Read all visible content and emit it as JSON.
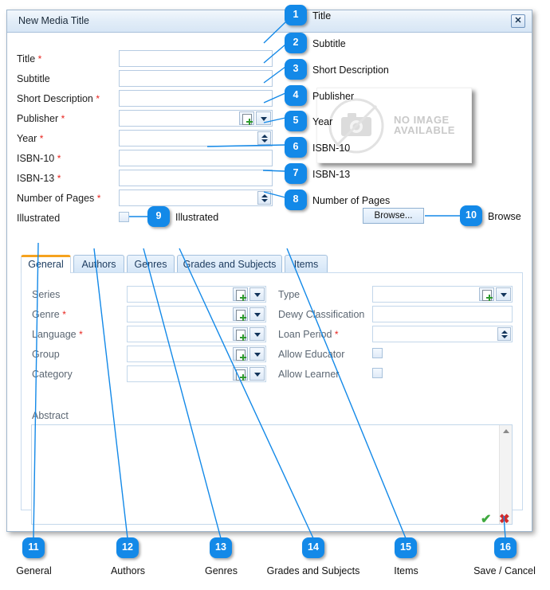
{
  "window": {
    "title": "New Media Title",
    "close_label": "✕"
  },
  "form": {
    "rows": [
      {
        "label": "Title",
        "required": "*",
        "control": "text"
      },
      {
        "label": "Subtitle",
        "required": "",
        "control": "text"
      },
      {
        "label": "Short Description",
        "required": "*",
        "control": "text"
      },
      {
        "label": "Publisher",
        "required": "*",
        "control": "lookup"
      },
      {
        "label": "Year",
        "required": "*",
        "control": "spinner"
      },
      {
        "label": "ISBN-10",
        "required": "*",
        "control": "text"
      },
      {
        "label": "ISBN-13",
        "required": "*",
        "control": "text"
      },
      {
        "label": "Number of Pages",
        "required": "*",
        "control": "spinner"
      },
      {
        "label": "Illustrated",
        "required": "",
        "control": "checkbox"
      }
    ]
  },
  "image_placeholder": {
    "line1": "NO IMAGE",
    "line2": "AVAILABLE"
  },
  "browse": {
    "label": "Browse..."
  },
  "tabs": [
    {
      "label": "General",
      "active": true
    },
    {
      "label": "Authors",
      "active": false
    },
    {
      "label": "Genres",
      "active": false
    },
    {
      "label": "Grades and Subjects",
      "active": false
    },
    {
      "label": "Items",
      "active": false
    }
  ],
  "general_tab": {
    "left_fields": [
      {
        "label": "Series",
        "required": "",
        "control": "lookup"
      },
      {
        "label": "Genre",
        "required": "*",
        "control": "lookup"
      },
      {
        "label": "Language",
        "required": "*",
        "control": "lookup"
      },
      {
        "label": "Group",
        "required": "",
        "control": "lookup"
      },
      {
        "label": "Category",
        "required": "",
        "control": "lookup"
      }
    ],
    "right_fields": [
      {
        "label": "Type",
        "required": "",
        "control": "lookup"
      },
      {
        "label": "Dewy Classification",
        "required": "",
        "control": "text"
      },
      {
        "label": "Loan Period",
        "required": "*",
        "control": "spinner"
      },
      {
        "label": "Allow Educator",
        "required": "",
        "control": "checkbox"
      },
      {
        "label": "Allow Learner",
        "required": "",
        "control": "checkbox"
      }
    ],
    "abstract_label": "Abstract"
  },
  "actions": {
    "save_icon": "✔",
    "cancel_icon": "✖"
  },
  "callouts": [
    {
      "num": "1",
      "text": "Title"
    },
    {
      "num": "2",
      "text": "Subtitle"
    },
    {
      "num": "3",
      "text": "Short Description"
    },
    {
      "num": "4",
      "text": "Publisher"
    },
    {
      "num": "5",
      "text": "Year"
    },
    {
      "num": "6",
      "text": "ISBN-10"
    },
    {
      "num": "7",
      "text": "ISBN-13"
    },
    {
      "num": "8",
      "text": "Number of Pages"
    },
    {
      "num": "9",
      "text": "Illustrated"
    },
    {
      "num": "10",
      "text": "Browse"
    },
    {
      "num": "11",
      "text": "General"
    },
    {
      "num": "12",
      "text": "Authors"
    },
    {
      "num": "13",
      "text": "Genres"
    },
    {
      "num": "14",
      "text": "Grades and Subjects"
    },
    {
      "num": "15",
      "text": "Items"
    },
    {
      "num": "16",
      "text": "Save / Cancel"
    }
  ],
  "colors": {
    "callout_blue": "#1389e8",
    "active_tab_accent": "#f5a21e",
    "required_red": "#e8251f",
    "save_green": "#3fa93f",
    "cancel_red": "#d42a2a"
  }
}
